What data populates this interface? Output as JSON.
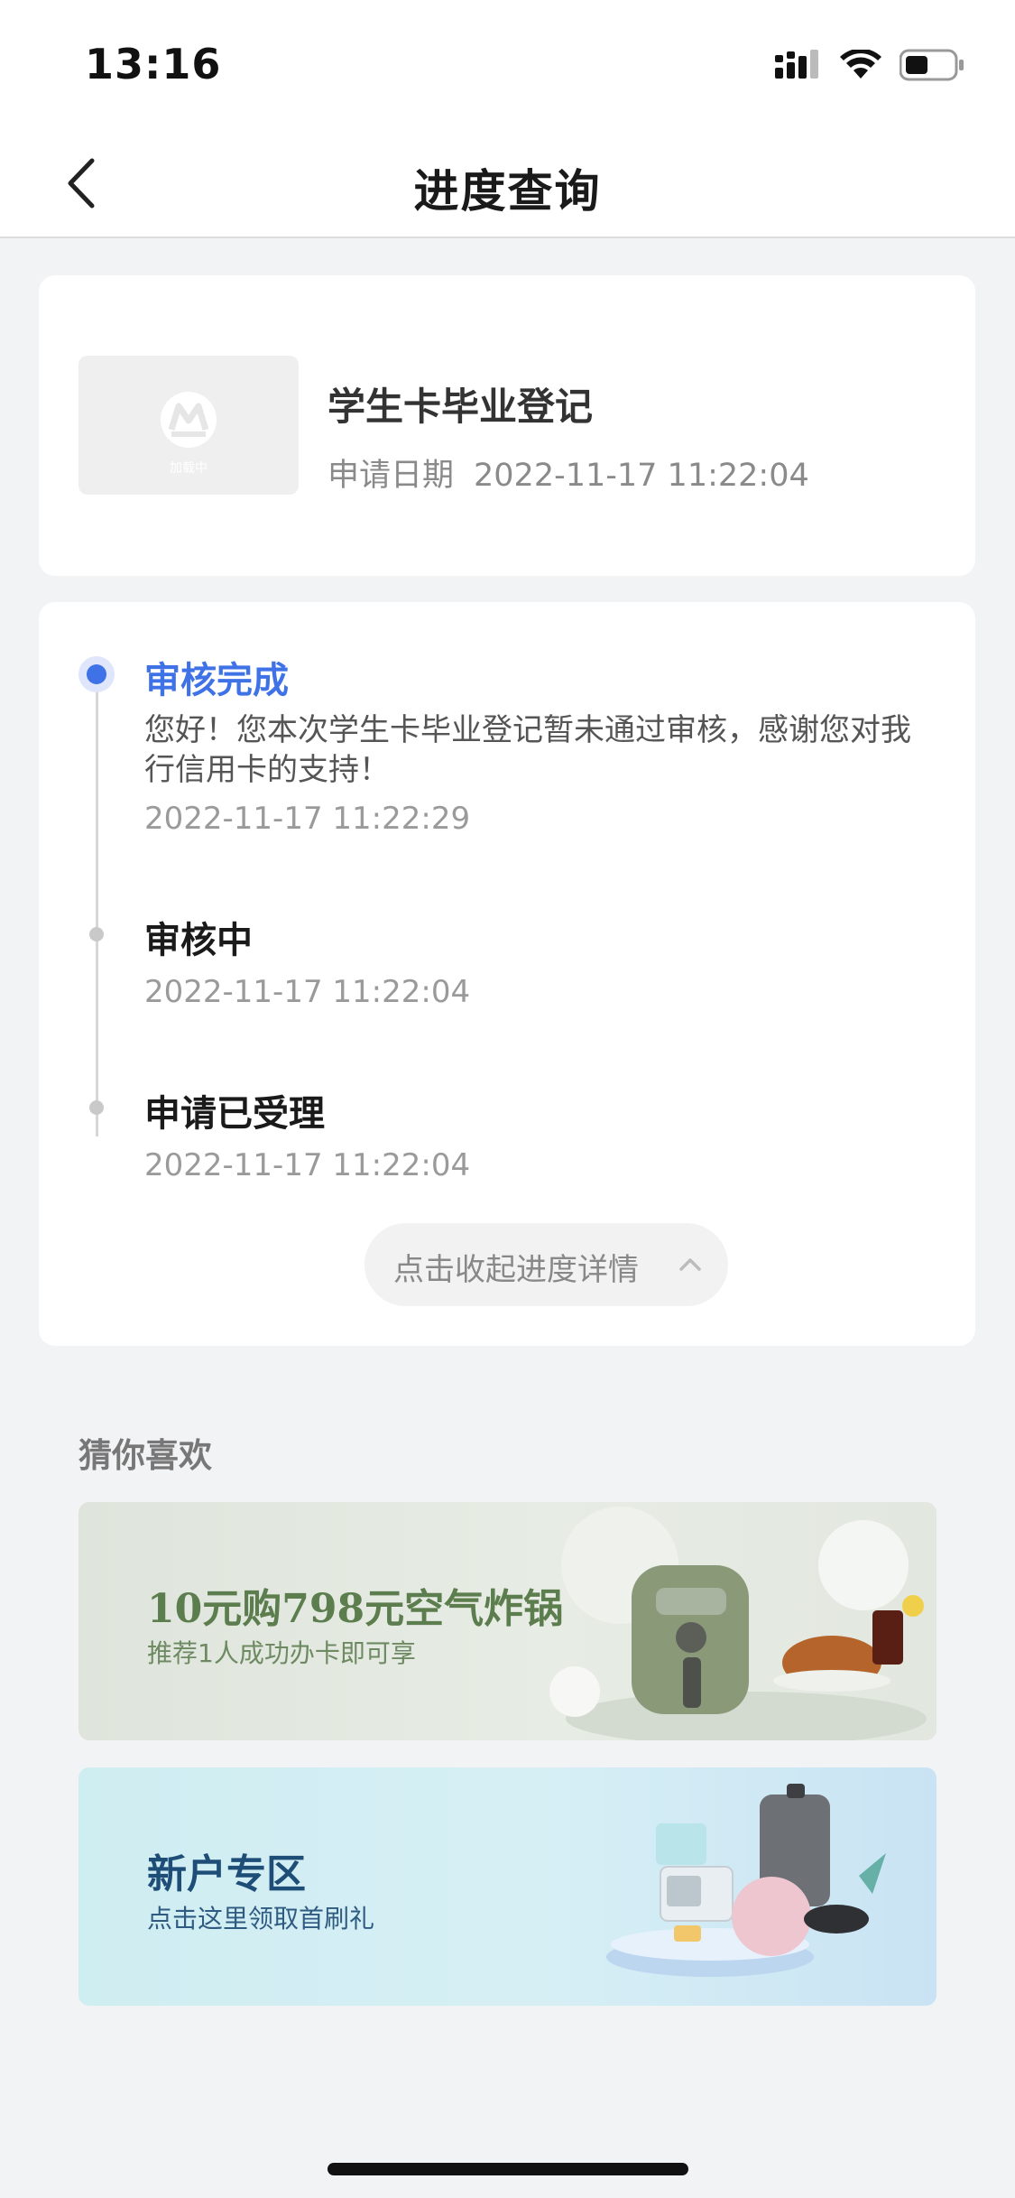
{
  "status": {
    "time": "13:16",
    "icons": [
      "signal-icon",
      "wifi-icon",
      "battery-icon"
    ]
  },
  "nav": {
    "title": "进度查询",
    "back_icon": "chevron-left-icon"
  },
  "application": {
    "title": "学生卡毕业登记",
    "date_label": "申请日期",
    "date_value": "2022-11-17 11:22:04",
    "thumbnail_caption": "加载中"
  },
  "progress": {
    "steps": [
      {
        "title": "审核完成",
        "description": "您好！您本次学生卡毕业登记暂未通过审核，感谢您对我行信用卡的支持！",
        "time": "2022-11-17 11:22:29",
        "active": true
      },
      {
        "title": "审核中",
        "time": "2022-11-17 11:22:04",
        "active": false
      },
      {
        "title": "申请已受理",
        "time": "2022-11-17 11:22:04",
        "active": false
      }
    ],
    "collapse_label": "点击收起进度详情"
  },
  "recommend": {
    "title": "猜你喜欢",
    "banners": [
      {
        "title": "10元购798元空气炸锅",
        "subtitle": "推荐1人成功办卡即可享"
      },
      {
        "title": "新户专区",
        "subtitle": "点击这里领取首刷礼"
      }
    ]
  },
  "colors": {
    "accent": "#3f72e6",
    "background": "#f2f3f5"
  }
}
